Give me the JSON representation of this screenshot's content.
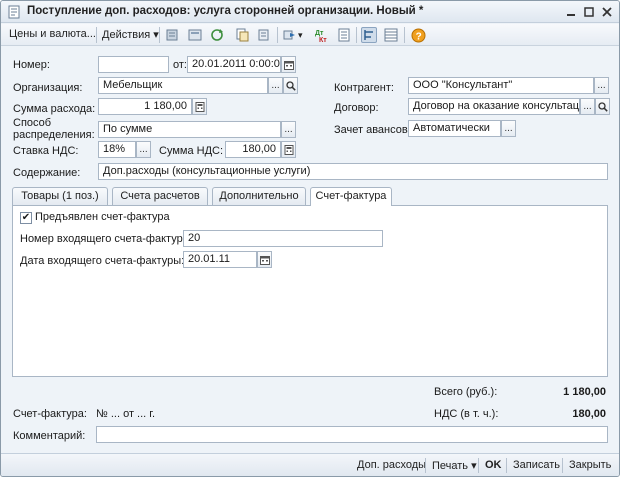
{
  "window": {
    "title": "Поступление доп. расходов: услуга сторонней организации. Новый *"
  },
  "toolbar": {
    "prices_label": "Цены и валюта...",
    "actions_label": "Действия",
    "actions_arrow": "▾"
  },
  "form": {
    "number_label": "Номер:",
    "number_value": "",
    "date_from_label": "от:",
    "date_value": "20.01.2011  0:00:00",
    "organization_label": "Организация:",
    "organization_value": "Мебельщик",
    "counterparty_label": "Контрагент:",
    "counterparty_value": "ООО \"Консультант\"",
    "amount_label": "Сумма расхода:",
    "amount_value": "1 180,00",
    "contract_label": "Договор:",
    "contract_value": "Договор на оказание консультационных",
    "distribution_label_1": "Способ",
    "distribution_label_2": "распределения:",
    "distribution_value": "По сумме",
    "advances_label": "Зачет авансов:",
    "advances_value": "Автоматически",
    "vat_rate_label": "Ставка НДС:",
    "vat_rate_value": "18%",
    "vat_sum_label": "Сумма НДС:",
    "vat_sum_value": "180,00",
    "content_label": "Содержание:",
    "content_value": "Доп.расходы (консультационные услуги)"
  },
  "tabs": [
    {
      "label": "Товары (1 поз.)"
    },
    {
      "label": "Счета расчетов"
    },
    {
      "label": "Дополнительно"
    },
    {
      "label": "Счет-фактура"
    }
  ],
  "invoice_tab": {
    "presented_label": "Предъявлен счет-фактура",
    "presented_checked": "✔",
    "incoming_number_label": "Номер входящего счета-фактуры:",
    "incoming_number_value": "20",
    "incoming_date_label": "Дата входящего счета-фактуры:",
    "incoming_date_value": "20.01.11"
  },
  "totals": {
    "total_label": "Всего (руб.):",
    "total_value": "1 180,00",
    "vat_label": "НДС (в т. ч.):",
    "vat_value": "180,00"
  },
  "footer": {
    "invoice_label": "Счет-фактура:",
    "invoice_text": "№ ... от ... г.",
    "comment_label": "Комментарий:",
    "comment_value": ""
  },
  "bottom": {
    "extra_costs": "Доп. расходы",
    "print": "Печать",
    "print_arrow": "▾",
    "ok": "OK",
    "save": "Записать",
    "close": "Закрыть"
  },
  "colors": {
    "window_bg": "#eef3f8",
    "accent_orange": "#e8a23a",
    "help_icon": "#f0a020"
  }
}
